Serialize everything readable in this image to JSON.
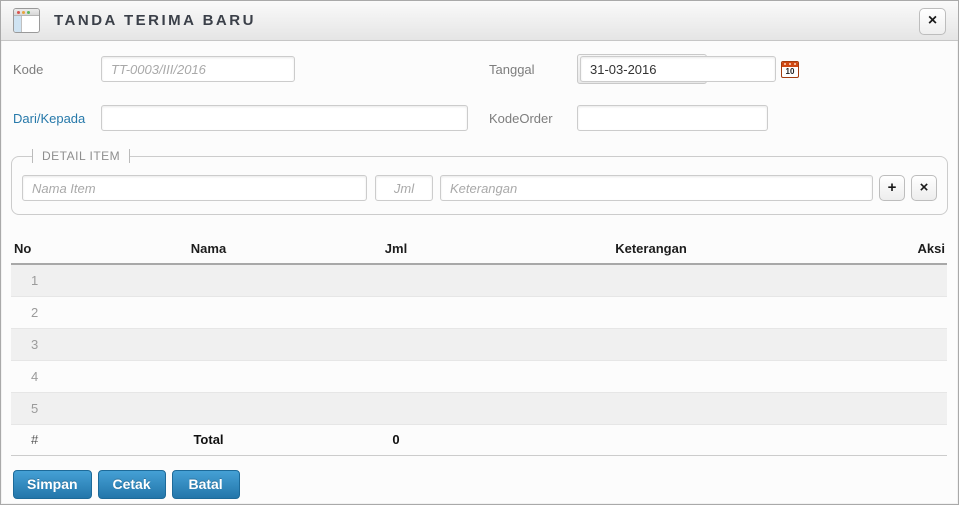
{
  "dialog": {
    "title": "TANDA TERIMA BARU",
    "close_label": "×"
  },
  "form": {
    "kode": {
      "label": "Kode",
      "placeholder": "TT-0003/III/2016",
      "value": ""
    },
    "tanggal": {
      "label": "Tanggal",
      "value": "31-03-2016",
      "calendar_day": "10"
    },
    "dari_kepada": {
      "label": "Dari/Kepada",
      "value": "",
      "placeholder": ""
    },
    "kode_order": {
      "label": "KodeOrder",
      "value": "",
      "placeholder": ""
    }
  },
  "detail_item": {
    "legend": "DETAIL ITEM",
    "nama_placeholder": "Nama Item",
    "jml_placeholder": "Jml",
    "keterangan_placeholder": "Keterangan",
    "add_label": "+",
    "remove_label": "×"
  },
  "table": {
    "headers": {
      "no": "No",
      "nama": "Nama",
      "jml": "Jml",
      "keterangan": "Keterangan",
      "aksi": "Aksi"
    },
    "rows": [
      {
        "no": "1",
        "nama": "",
        "jml": "",
        "keterangan": "",
        "aksi": ""
      },
      {
        "no": "2",
        "nama": "",
        "jml": "",
        "keterangan": "",
        "aksi": ""
      },
      {
        "no": "3",
        "nama": "",
        "jml": "",
        "keterangan": "",
        "aksi": ""
      },
      {
        "no": "4",
        "nama": "",
        "jml": "",
        "keterangan": "",
        "aksi": ""
      },
      {
        "no": "5",
        "nama": "",
        "jml": "",
        "keterangan": "",
        "aksi": ""
      }
    ],
    "footer": {
      "no": "#",
      "total_label": "Total",
      "total_value": "0"
    }
  },
  "actions": {
    "save": "Simpan",
    "print": "Cetak",
    "cancel": "Batal"
  },
  "colors": {
    "button_blue_top": "#45a0d5",
    "button_blue_bottom": "#2376aa",
    "link_blue": "#2779aa",
    "stripe_gray": "#f0f0f0",
    "calendar_orange": "#cf4913"
  }
}
